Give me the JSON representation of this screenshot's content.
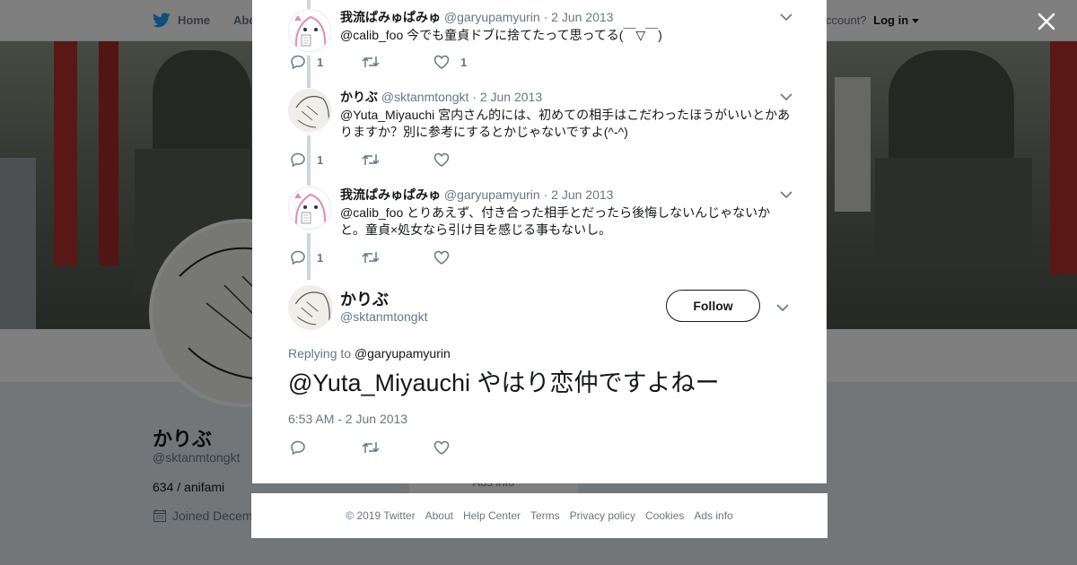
{
  "topnav": {
    "home": "Home",
    "about": "Abo",
    "account_prompt": "ccount?",
    "login": "Log in"
  },
  "profile": {
    "name": "かりぶ",
    "handle": "@sktanmtongkt",
    "bio": "634 / anifami",
    "joined": "Joined Decem",
    "card_peek": "Ads info"
  },
  "thread": [
    {
      "name": "我流ぱみゅぱみゅ",
      "handle": "@garyupamyurin",
      "date": "2 Jun 2013",
      "text": "@calib_foo 今でも童貞ドブに捨てたって思ってる(￣▽￣)",
      "replies": "1",
      "retweets": "",
      "likes": "1",
      "avatar": "anime-girl-avatar"
    },
    {
      "name": "かりぶ",
      "handle": "@sktanmtongkt",
      "date": "2 Jun 2013",
      "text": "@Yuta_Miyauchi 宮内さん的には、初めての相手はこだわったほうがいいとかありますか？別に参考にするとかじゃないですよ(^-^)",
      "replies": "1",
      "retweets": "",
      "likes": "",
      "avatar": "sketch-avatar"
    },
    {
      "name": "我流ぱみゅぱみゅ",
      "handle": "@garyupamyurin",
      "date": "2 Jun 2013",
      "text": "@calib_foo とりあえず、付き合った相手とだったら後悔しないんじゃないかと。童貞×処女なら引け目を感じる事もないし。",
      "replies": "1",
      "retweets": "",
      "likes": "",
      "avatar": "anime-girl-avatar"
    }
  ],
  "main_tweet": {
    "name": "かりぶ",
    "handle": "@sktanmtongkt",
    "follow_label": "Follow",
    "replying_prefix": "Replying to",
    "replying_to": "@garyupamyurin",
    "text": "@Yuta_Miyauchi やはり恋仲ですよねー",
    "timestamp": "6:53 AM - 2 Jun 2013"
  },
  "footer": [
    "© 2019 Twitter",
    "About",
    "Help Center",
    "Terms",
    "Privacy policy",
    "Cookies",
    "Ads info"
  ],
  "colors": {
    "accent": "#1da1f2",
    "text": "#14171a",
    "muted": "#657786",
    "thread_line": "#ccd6dd"
  }
}
